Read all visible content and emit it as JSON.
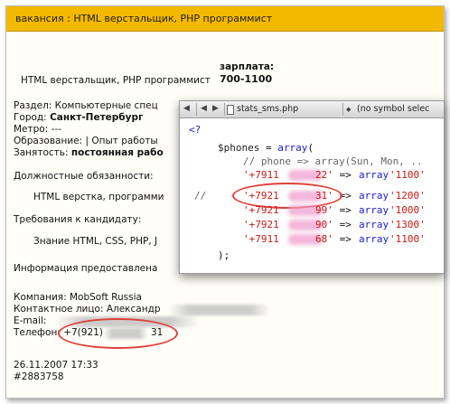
{
  "header": {
    "title": "вакансия : HTML верстальщик, PHP программист"
  },
  "job": {
    "name": "HTML верстальщик, PHP программист",
    "salary_label": "зарплата:",
    "salary_value": "700-1100"
  },
  "details": {
    "section_label": "Раздел: Компьютерные спец",
    "city_label": "Город:",
    "city_value": "Санкт-Петербург",
    "metro": "Метро: ---",
    "education": "Образование: | Опыт работы",
    "employment_label": "Занятость:",
    "employment_value": "постоянная рабо"
  },
  "duties": {
    "title": "Должностные обязанности:",
    "text": "HTML верстка, программи"
  },
  "requirements": {
    "title": "Требования к кандидату:",
    "text": "Знание HTML, CSS, PHP, J"
  },
  "info": "Информация предоставлена",
  "contacts": {
    "company": "Компания: MobSoft Russia",
    "person": "Контактное лицо: Александр",
    "email_label": "E-mail:",
    "phone_label": "Телефон:",
    "phone_start": "+7(921)",
    "phone_end": "31"
  },
  "footer": {
    "date": "26.11.2007 17:33",
    "id": "#2883758"
  },
  "code_window": {
    "toolbar": {
      "triangle": "◀",
      "back": "◀",
      "forward": "▶",
      "file_icon": "document-icon",
      "file": "stats_sms.php",
      "chevron": "◆",
      "symbol": "(no symbol selec"
    },
    "lines": {
      "php_open": "<?",
      "var": "$phones",
      "eq": " = ",
      "arr": "array",
      "paren": "(",
      "comment": "// phone => array(Sun, Mon, ..",
      "comment_prefix": "//",
      "row1_a": "'+7911",
      "row1_b": "22'",
      "row1_val": "'1100'",
      "row2_a": "'+7921",
      "row2_b": "31'",
      "row2_val": "'1200'",
      "row3_a": "'+7921",
      "row3_b": "99'",
      "row3_val": "'1000'",
      "row4_a": "'+7921",
      "row4_b": "90'",
      "row4_val": "'1300'",
      "row5_a": "'+7911",
      "row5_b": "68'",
      "row5_val": "'1100'",
      "arrow": " => ",
      "close": ");"
    }
  },
  "colors": {
    "header_bg": "#f3b800",
    "highlight": "#e0403a",
    "string": "#c41a16",
    "keyword": "#1a1ad0"
  }
}
